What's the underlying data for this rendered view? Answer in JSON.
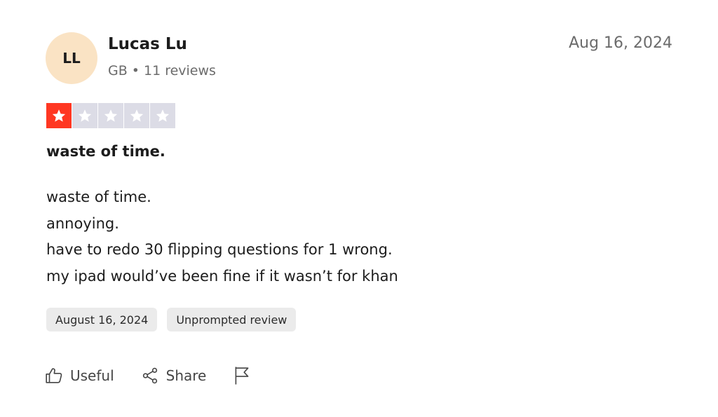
{
  "reviewer": {
    "initials": "LL",
    "name": "Lucas Lu",
    "country": "GB",
    "separator": "•",
    "review_count": "11 reviews"
  },
  "review": {
    "date": "Aug 16, 2024",
    "rating": 1,
    "rating_max": 5,
    "title": "waste of time.",
    "body_lines": [
      "waste of time.",
      "annoying.",
      "have to redo 30 flipping questions for 1 wrong.",
      "my ipad would’ve been fine if it wasn’t for khan"
    ]
  },
  "tags": {
    "date_of_experience": "August 16, 2024",
    "source": "Unprompted review"
  },
  "actions": {
    "useful_label": "Useful",
    "share_label": "Share"
  },
  "colors": {
    "star_filled": "#ff3722",
    "star_empty": "#dcdce6",
    "avatar_bg": "#fae3c4"
  },
  "icons": {
    "useful": "thumbs-up-icon",
    "share": "share-icon",
    "report": "flag-icon",
    "star": "star-icon"
  }
}
